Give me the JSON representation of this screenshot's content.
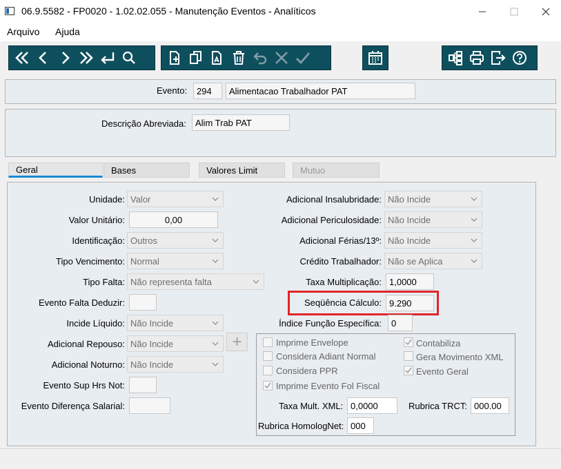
{
  "window": {
    "title": "06.9.5582 - FP0020 - 1.02.02.055 - Manutenção Eventos - Analíticos"
  },
  "menu": {
    "items": [
      "Arquivo",
      "Ajuda"
    ]
  },
  "toolbar": {
    "icons": [
      "first-record-icon",
      "previous-record-icon",
      "next-record-icon",
      "last-record-icon",
      "return-icon",
      "search-icon",
      "new-record-icon",
      "copy-icon",
      "edit-icon",
      "delete-icon",
      "undo-icon",
      "cancel-icon",
      "confirm-icon",
      "calendar-icon",
      "hierarchy-icon",
      "print-icon",
      "exit-icon",
      "help-icon"
    ],
    "bg_color": "#0e4f5e"
  },
  "header": {
    "evento_label": "Evento:",
    "evento_code": "294",
    "evento_name": "Alimentacao Trabalhador PAT",
    "descricao_label": "Descrição Abreviada:",
    "descricao_value": "Alim Trab PAT"
  },
  "tabs": [
    {
      "label": "Geral",
      "active": true
    },
    {
      "label": "Bases",
      "active": false
    },
    {
      "label": "Valores Limit",
      "active": false
    },
    {
      "label": "Mutuo",
      "active": false,
      "disabled": true
    }
  ],
  "left_fields": {
    "unidade": {
      "label": "Unidade:",
      "value": "Valor"
    },
    "valor_unitario": {
      "label": "Valor Unitário:",
      "value": "0,00"
    },
    "identificacao": {
      "label": "Identificação:",
      "value": "Outros"
    },
    "tipo_vencimento": {
      "label": "Tipo Vencimento:",
      "value": "Normal"
    },
    "tipo_falta": {
      "label": "Tipo Falta:",
      "value": "Não representa falta"
    },
    "evento_falta_deduzir": {
      "label": "Evento Falta Deduzir:",
      "value": ""
    },
    "incide_liquido": {
      "label": "Incide Líquido:",
      "value": "Não Incide"
    },
    "adicional_repouso": {
      "label": "Adicional Repouso:",
      "value": "Não Incide"
    },
    "adicional_noturno": {
      "label": "Adicional Noturno:",
      "value": "Não Incide"
    },
    "evento_sup_hrs_not": {
      "label": "Evento Sup Hrs Not:",
      "value": ""
    },
    "evento_diferenca_salarial": {
      "label": "Evento Diferença Salarial:",
      "value": ""
    }
  },
  "right_fields": {
    "adicional_insalubridade": {
      "label": "Adicional Insalubridade:",
      "value": "Não Incide"
    },
    "adicional_periculosidade": {
      "label": "Adicional Periculosidade:",
      "value": "Não Incide"
    },
    "adicional_ferias": {
      "label": "Adicional Férias/13º:",
      "value": "Não Incide"
    },
    "credito_trabalhador": {
      "label": "Crédito Trabalhador:",
      "value": "Não se Aplica"
    },
    "taxa_multiplicacao": {
      "label": "Taxa Multiplicação:",
      "value": "1,0000"
    },
    "sequencia_calculo": {
      "label": "Seqüência Cálculo:",
      "value": "9.290",
      "highlight_color": "#e0242a"
    },
    "indice_funcao": {
      "label": "Índice Função Específica:",
      "value": "0"
    }
  },
  "checkboxes": [
    {
      "label": "Imprime Envelope",
      "checked": false
    },
    {
      "label": "Contabiliza",
      "checked": true
    },
    {
      "label": "Considera Adiant Normal",
      "checked": false
    },
    {
      "label": "Gera Movimento XML",
      "checked": false
    },
    {
      "label": "Considera PPR",
      "checked": false
    },
    {
      "label": "Evento Geral",
      "checked": true
    },
    {
      "label": "Imprime Evento Fol Fiscal",
      "checked": true
    }
  ],
  "bottom_fields": {
    "taxa_mult_xml": {
      "label": "Taxa Mult. XML:",
      "value": "0,0000"
    },
    "rubrica_trct": {
      "label": "Rubrica TRCT:",
      "value": "000.00"
    },
    "rubrica_homolognet": {
      "label": "Rubrica HomologNet:",
      "value": "000"
    }
  },
  "add_button_label": "+"
}
